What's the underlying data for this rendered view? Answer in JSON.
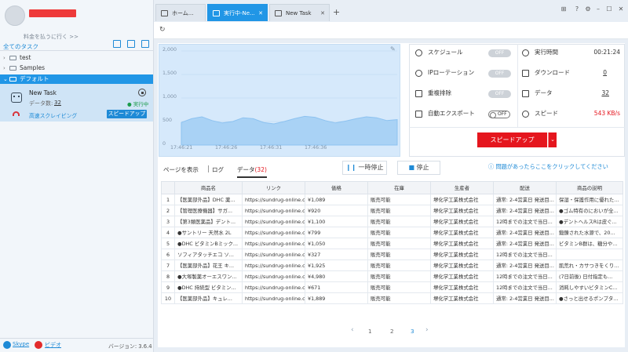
{
  "sidebar": {
    "pay_link": "料金を払うに行く >>",
    "all_tasks": "全てのタスク",
    "tree": [
      {
        "label": "test"
      },
      {
        "label": "Samples"
      },
      {
        "label": "デフォルト"
      }
    ],
    "task": {
      "name": "New Task",
      "count_label": "データ数:",
      "count": "32",
      "status": "● 実行中",
      "mode": "高速スクレイピング",
      "speedup": "スピードアップ"
    },
    "skype": "Skype",
    "video": "ビデオ",
    "version": "バージョン: 3.6.4"
  },
  "tabs": [
    {
      "label": "ホーム..."
    },
    {
      "label": "実行中-Ne..."
    },
    {
      "label": "New Task"
    }
  ],
  "chart_data": {
    "type": "area",
    "x": [
      "17:46:21",
      "17:46:26",
      "17:46:31",
      "17:46:36"
    ],
    "ylim": [
      0,
      2000
    ],
    "yticks": [
      "2,000",
      "1,500",
      "1,000",
      "500",
      "0"
    ],
    "values": [
      480,
      560,
      600,
      520,
      470,
      500,
      580,
      560,
      480,
      450,
      500,
      560,
      610,
      590,
      520,
      470,
      510,
      560,
      600,
      580,
      520,
      540
    ],
    "color": "#a9d2f5"
  },
  "stats": {
    "schedule": "スケジュール",
    "schedule_state": "OFF",
    "ip_rotation": "IPローテーション",
    "ip_state": "OFF",
    "dedupe": "重複排除",
    "dedupe_state": "OFF",
    "auto_export": "自動エクスポート",
    "auto_export_state": "OFF",
    "runtime_label": "実行時間",
    "runtime": "00:21:24",
    "download_label": "ダウンロード",
    "download": "0",
    "data_label": "データ",
    "data": "32",
    "speed_label": "スピード",
    "speed": "543 KB/s",
    "speedup_button": "スピードアップ"
  },
  "subtabs": {
    "view_page": "ページを表示",
    "log": "ログ",
    "data_label": "データ",
    "data_count": "(32)"
  },
  "controls": {
    "pause": "一時停止",
    "stop": "停止",
    "help": "問題があったらここをクリックしてください"
  },
  "table": {
    "columns": [
      "",
      "商品名",
      "リンク",
      "価格",
      "在庫",
      "生産者",
      "配送",
      "商品の説明"
    ],
    "rows": [
      [
        "1",
        "【医薬部外品】DHC 薬...",
        "https://sundrug-online.c...",
        "¥1,089",
        "販売可能",
        "堺化学工業株式会社",
        "通常: 2-4営業日 発送目...",
        "保湿・保護作用に優れた..."
      ],
      [
        "2",
        "【管理医療機器】サガ...",
        "https://sundrug-online.c...",
        "¥920",
        "販売可能",
        "堺化学工業株式会社",
        "通常: 2-4営業日 発送目...",
        "●ゴム特有のにおいが全..."
      ],
      [
        "3",
        "【第3類医薬品】デント...",
        "https://sundrug-online.c...",
        "¥1,100",
        "販売可能",
        "堺化学工業株式会社",
        "12時までの注文で当日...",
        "●デントヘルスRは皮ぐ..."
      ],
      [
        "4",
        "●サントリー 天然水 2L",
        "https://sundrug-online.c...",
        "¥799",
        "販売可能",
        "堺化学工業株式会社",
        "通常: 2-4営業日 発送目...",
        "鍛錬された水源で、20..."
      ],
      [
        "5",
        "●DHC ビタミンBミック...",
        "https://sundrug-online.c...",
        "¥1,050",
        "販売可能",
        "堺化学工業株式会社",
        "通常: 2-4営業日 発送目...",
        "ビタミンB群は、糖分や..."
      ],
      [
        "6",
        "ソフィアタッチエコ ソ...",
        "https://sundrug-online.c...",
        "¥327",
        "販売可能",
        "堺化学工業株式会社",
        "12時までの注文で当日...",
        ""
      ],
      [
        "7",
        "【医薬部外品】花王 キ...",
        "https://sundrug-online.c...",
        "¥1,925",
        "販売可能",
        "堺化学工業株式会社",
        "通常: 2-4営業日 発送目...",
        "肌荒れ・カサつきをくり..."
      ],
      [
        "8",
        "●大塚製薬オーエスワン...",
        "https://sundrug-online.c...",
        "¥4,980",
        "販売可能",
        "堺化学工業株式会社",
        "12時までの注文で当日...",
        "(7日前後) 日付指定も..."
      ],
      [
        "9",
        "●DHC 持続型 ビタミン...",
        "https://sundrug-online.c...",
        "¥671",
        "販売可能",
        "堺化学工業株式会社",
        "12時までの注文で当日...",
        "消耗しやすいビタミンC..."
      ],
      [
        "10",
        "【医薬部外品】キュレ...",
        "https://sundrug-online.c...",
        "¥1,889",
        "販売可能",
        "堺化学工業株式会社",
        "通常: 2-4営業日 発送目...",
        "●さっと出せるポンプタ..."
      ]
    ]
  },
  "pager": {
    "pages": [
      "1",
      "2",
      "3"
    ],
    "active": "3"
  }
}
